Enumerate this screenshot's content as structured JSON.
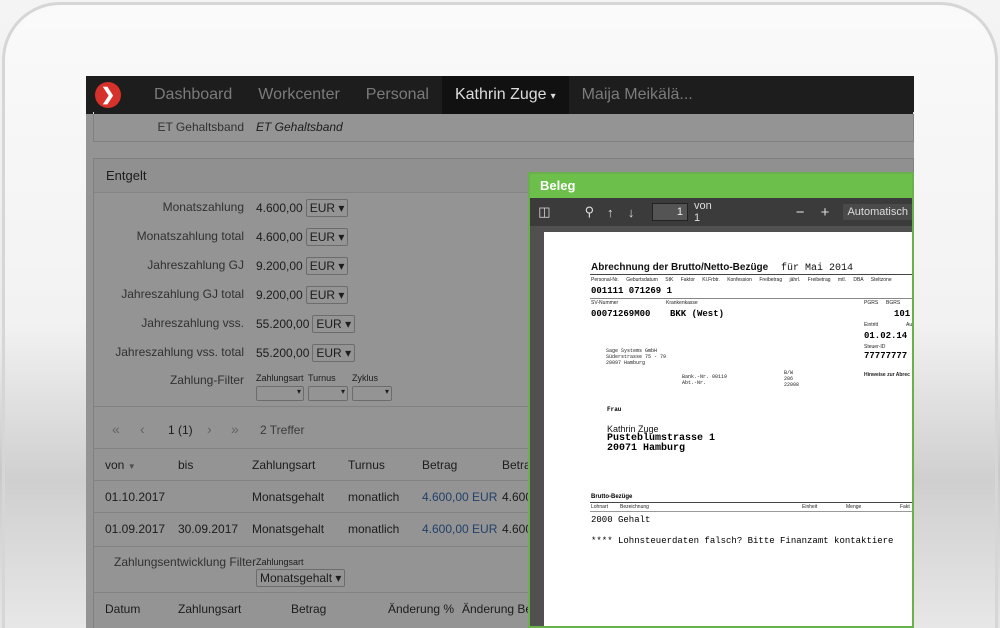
{
  "navbar": {
    "items": [
      "Dashboard",
      "Workcenter",
      "Personal",
      "Kathrin Zuge",
      "Maija Meikälä..."
    ],
    "caret": "▾"
  },
  "page": {
    "et_label": "ET Gehaltsband",
    "et_value": "ET Gehaltsband",
    "entgelt_title": "Entgelt",
    "fields": [
      {
        "label": "Monatszahlung",
        "value": "4.600,00",
        "currency": "EUR"
      },
      {
        "label": "Monatszahlung total",
        "value": "4.600,00",
        "currency": "EUR"
      },
      {
        "label": "Jahreszahlung GJ",
        "value": "9.200,00",
        "currency": "EUR"
      },
      {
        "label": "Jahreszahlung GJ total",
        "value": "9.200,00",
        "currency": "EUR"
      },
      {
        "label": "Jahreszahlung vss.",
        "value": "55.200,00",
        "currency": "EUR"
      },
      {
        "label": "Jahreszahlung vss. total",
        "value": "55.200,00",
        "currency": "EUR"
      }
    ],
    "filter_label": "Zahlung-Filter",
    "filter_cols": [
      "Zahlungsart",
      "Turnus",
      "Zyklus"
    ],
    "pager": {
      "first": "«",
      "prev": "‹",
      "page": "1 (1)",
      "next": "›",
      "last": "»",
      "count": "2 Treffer"
    },
    "table_headers": [
      "von",
      "bis",
      "Zahlungsart",
      "Turnus",
      "Betrag",
      "Betra"
    ],
    "sort_icon": "▼",
    "rows": [
      {
        "von": "01.10.2017",
        "bis": "",
        "art": "Monatsgehalt",
        "turnus": "monatlich",
        "betrag": "4.600,00 EUR",
        "betrag2": "4.600"
      },
      {
        "von": "01.09.2017",
        "bis": "30.09.2017",
        "art": "Monatsgehalt",
        "turnus": "monatlich",
        "betrag": "4.600,00 EUR",
        "betrag2": "4.600"
      }
    ],
    "entwicklung_label": "Zahlungsentwicklung Filter",
    "entwicklung_col": "Zahlungsart",
    "entwicklung_value": "Monatsgehalt",
    "bottom_headers": [
      "Datum",
      "Zahlungsart",
      "Betrag",
      "Änderung %",
      "Änderung Bet"
    ]
  },
  "modal": {
    "title": "Beleg",
    "page_value": "1",
    "page_of": "von 1",
    "minus": "−",
    "plus": "+",
    "zoom": "Automatisch"
  },
  "document": {
    "title": "Abrechnung der Brutto/Netto-Bezüge",
    "period": "für Mai 2014",
    "header_cols": [
      "Personal-Nr.",
      "Geburtsdatum",
      "StK",
      "Faktor",
      "Kl.Frbtr.",
      "Konfession",
      "Freibetrag jährl.",
      "Freibetrag mtl.",
      "DBA",
      "Steltzone"
    ],
    "id_line": "001111 071269 1",
    "sv_label": "SV-Nummer",
    "kk_label": "Krankenkasse",
    "sv_value": "00071269M00",
    "kk_value": "BKK (West)",
    "pgrs": "PGRS",
    "bgrs": "BGRS",
    "num101": "101",
    "eintritt_label": "Eintritt",
    "au_label": "Au",
    "eintritt_value": "01.02.14",
    "steuer_label": "Steuer-ID",
    "steuer_value": "77777777",
    "hinweise": "Hinweise zur Abrec",
    "sender_1": "Sage Systems GmbH",
    "sender_2": "Süderstrasse 75 - 79",
    "sender_3": "20097 Hamburg",
    "ref_1": "Bank.-Nr. 00119",
    "ref_2": "Abt.-Nr.",
    "ref_3": "B/W",
    "ref_4": "206",
    "ref_5": "22008",
    "salutation": "Frau",
    "recipient_name": "Kathrin Zuge",
    "recipient_street": "Pusteblumstrasse 1",
    "recipient_city": "20071 Hamburg",
    "brutto_title": "Brutto-Bezüge",
    "brutto_cols": [
      "Lohnart",
      "Bezeichnung",
      "Einheit",
      "Menge",
      "Fakt"
    ],
    "brutto_line": "2000 Gehalt",
    "warning": "**** Lohnsteuerdaten falsch? Bitte Finanzamt kontaktiere"
  },
  "colors": {
    "navbar": "#1d1d1d",
    "modal_header": "#6cbf4a",
    "logo": "#d6322b",
    "link": "#3b6fb6"
  }
}
